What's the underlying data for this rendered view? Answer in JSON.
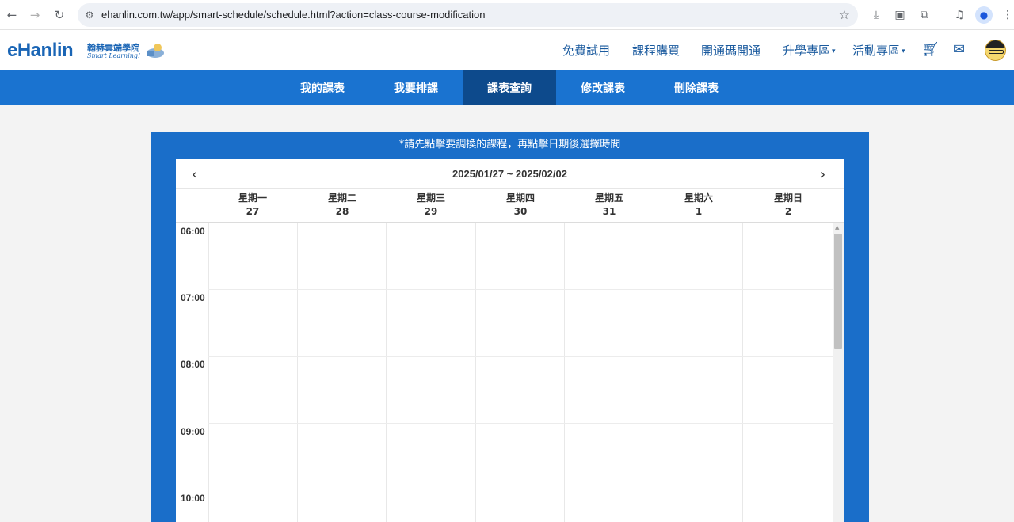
{
  "browser": {
    "url": "ehanlin.com.tw/app/smart-schedule/schedule.html?action=class-course-modification"
  },
  "site": {
    "logo": "eHanlin",
    "logo_cn": "翰赫雲端學院",
    "logo_en": "Smart Learning!",
    "nav": [
      "免費試用",
      "課程購買",
      "開通碼開通",
      "升學專區",
      "活動專區"
    ],
    "dropdown_caret": "▾"
  },
  "tabs": [
    {
      "label": "我的課表",
      "active": false
    },
    {
      "label": "我要排課",
      "active": false
    },
    {
      "label": "課表查詢",
      "active": true
    },
    {
      "label": "修改課表",
      "active": false
    },
    {
      "label": "刪除課表",
      "active": false
    }
  ],
  "schedule": {
    "hint": "*請先點擊要調換的課程，再點擊日期後選擇時間",
    "range": "2025/01/27 ~ 2025/02/02",
    "prev": "‹",
    "next": "›",
    "days": [
      {
        "name": "星期一",
        "date": "27"
      },
      {
        "name": "星期二",
        "date": "28"
      },
      {
        "name": "星期三",
        "date": "29"
      },
      {
        "name": "星期四",
        "date": "30"
      },
      {
        "name": "星期五",
        "date": "31"
      },
      {
        "name": "星期六",
        "date": "1"
      },
      {
        "name": "星期日",
        "date": "2"
      }
    ],
    "times": [
      "06:00",
      "07:00",
      "08:00",
      "09:00",
      "10:00"
    ]
  }
}
